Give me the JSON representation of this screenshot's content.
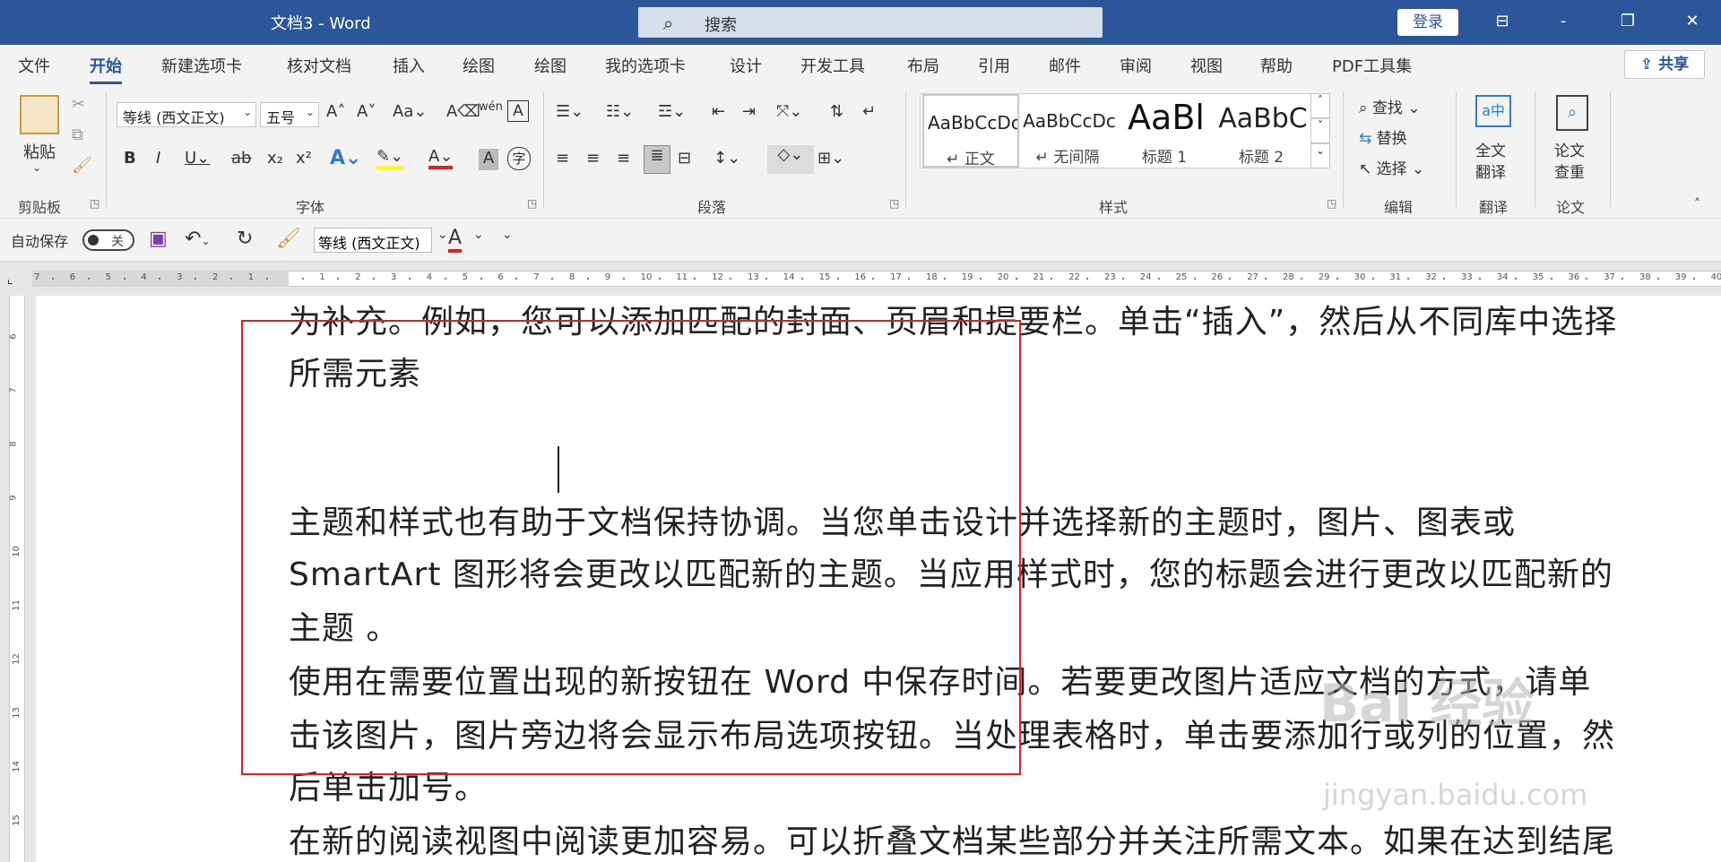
{
  "titlebar": {
    "title": "文档3 - Word",
    "search_placeholder": "搜索",
    "search_icon": "magnifier-icon",
    "login": "登录",
    "ribbon_display_icon": "ribbon-display-icon",
    "minimize": "-",
    "restore": "❐",
    "close": "✕"
  },
  "tabs": [
    "文件",
    "开始",
    "新建选项卡",
    "核对文档",
    "插入",
    "绘图",
    "绘图",
    "我的选项卡",
    "设计",
    "开发工具",
    "布局",
    "引用",
    "邮件",
    "审阅",
    "视图",
    "帮助",
    "PDF工具集"
  ],
  "active_tab": "开始",
  "share": "共享",
  "ribbon": {
    "clipboard": {
      "label": "剪贴板",
      "paste": "粘贴"
    },
    "font": {
      "label": "字体",
      "font_name": "等线 (西文正文)",
      "font_size": "五号"
    },
    "paragraph": {
      "label": "段落"
    },
    "styles": {
      "label": "样式",
      "items": [
        {
          "sample": "AaBbCcDc",
          "name": "↵ 正文"
        },
        {
          "sample": "AaBbCcDc",
          "name": "↵ 无间隔"
        },
        {
          "sample": "AaBl",
          "name": "标题 1"
        },
        {
          "sample": "AaBbC",
          "name": "标题 2"
        }
      ]
    },
    "editing": {
      "label": "编辑",
      "find": "查找",
      "replace": "替换",
      "select": "选择"
    },
    "translate": {
      "label": "翻译",
      "full": "全文",
      "translate": "翻译"
    },
    "paper": {
      "label": "论文",
      "paper": "论文",
      "check": "查重"
    }
  },
  "qat": {
    "autosave": "自动保存",
    "toggle_state": "关",
    "font_name": "等线 (西文正文)"
  },
  "ruler_numbers": [
    "7",
    "6",
    "5",
    "4",
    "3",
    "2",
    "1",
    "",
    "1",
    "2",
    "3",
    "4",
    "5",
    "6",
    "7",
    "8",
    "9",
    "10",
    "11",
    "12",
    "13",
    "14",
    "15",
    "16",
    "17",
    "18",
    "19",
    "20",
    "21",
    "22",
    "23",
    "24",
    "25",
    "26",
    "27",
    "28",
    "29",
    "30",
    "31",
    "32",
    "33",
    "34",
    "35",
    "36",
    "37",
    "38",
    "39",
    "40"
  ],
  "vruler_numbers": [
    "6",
    "7",
    "8",
    "9",
    "10",
    "11",
    "12",
    "13",
    "14",
    "15"
  ],
  "document": {
    "lines": [
      "为补充。例如，您可以添加匹配的封面、页眉和提要栏。单击“插入”，然后从不同库中选择",
      "所需元素",
      "",
      "主题和样式也有助于文档保持协调。当您单击设计并选择新的主题时，图片、图表或",
      "SmartArt 图形将会更改以匹配新的主题。当应用样式时，您的标题会进行更改以匹配新的",
      "主题                                    。",
      "使用在需要位置出现的新按钮在 Word 中保存时间。若要更改图片适应文档的方式，请单",
      "击该图片，图片旁边将会显示布局选项按钮。当处理表格时，单击要添加行或列的位置，然",
      "后单击加号。",
      "在新的阅读视图中阅读更加容易。可以折叠文档某些部分并关注所需文本。如果在达到结尾"
    ]
  },
  "watermark": {
    "brand": "Bai 经验",
    "url": "jingyan.baidu.com"
  },
  "colors": {
    "word_blue": "#2b579a",
    "highlight_box": "#e02020"
  }
}
